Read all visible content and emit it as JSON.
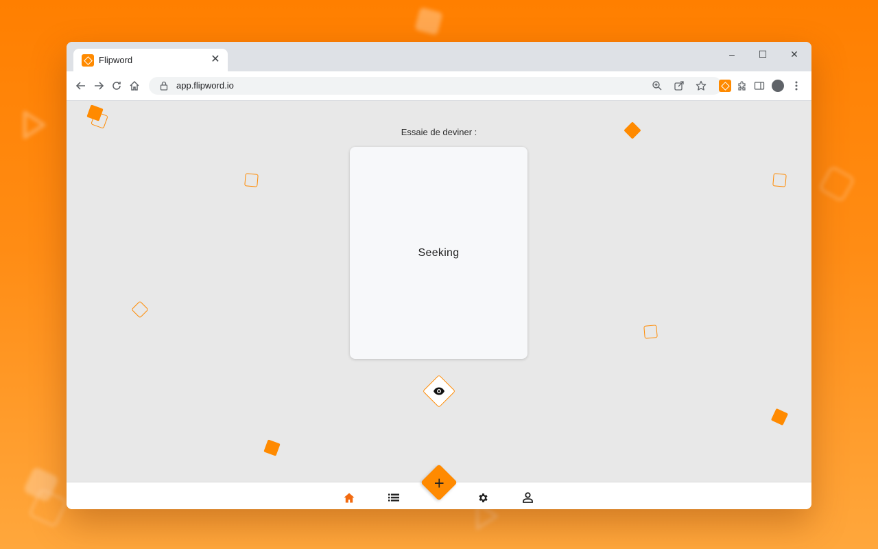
{
  "browser": {
    "tab_title": "Flipword",
    "url": "app.flipword.io",
    "tab_close": "✕",
    "window_controls": {
      "minimize": "–",
      "maximize": "☐",
      "close": "✕"
    }
  },
  "app": {
    "prompt": "Essaie de deviner :",
    "card_word": "Seeking",
    "fab_label": "+"
  },
  "icons": {
    "back": "arrow-left-icon",
    "forward": "arrow-right-icon",
    "reload": "reload-icon",
    "home": "home-icon",
    "lock": "lock-icon",
    "zoom": "zoom-icon",
    "share": "share-icon",
    "bookmark": "star-icon",
    "extension": "puzzle-icon",
    "side_panel": "side-panel-icon",
    "menu": "kebab-menu-icon",
    "reveal": "eye-icon"
  },
  "nav": {
    "items": [
      "home",
      "list",
      "add",
      "settings",
      "profile"
    ],
    "active": "home"
  },
  "colors": {
    "accent": "#ff8a00",
    "active_nav": "#f26a10",
    "background": "#e8e8e8"
  }
}
